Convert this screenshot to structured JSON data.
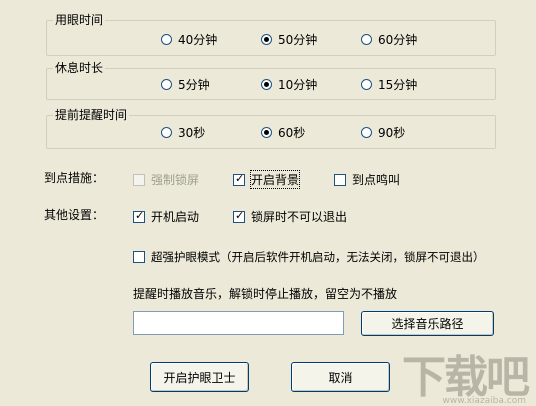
{
  "groups": [
    {
      "title": "用眼时间",
      "options": [
        "40分钟",
        "50分钟",
        "60分钟"
      ],
      "selected": 1
    },
    {
      "title": "休息时长",
      "options": [
        "5分钟",
        "10分钟",
        "15分钟"
      ],
      "selected": 1
    },
    {
      "title": "提前提醒时间",
      "options": [
        "30秒",
        "60秒",
        "90秒"
      ],
      "selected": 1
    }
  ],
  "arrival": {
    "label": "到点措施：",
    "force_lock": "强制锁屏",
    "open_background": "开启背景",
    "beep": "到点鸣叫"
  },
  "other": {
    "label": "其他设置：",
    "startup": "开机启动",
    "lock_no_exit": "锁屏时不可以退出",
    "super_mode": "超强护眼模式（开启后软件开机启动，无法关闭，锁屏不可退出）"
  },
  "music": {
    "hint": "提醒时播放音乐，解锁时停止播放，留空为不播放",
    "path_value": "",
    "choose_button": "选择音乐路径"
  },
  "buttons": {
    "start": "开启护眼卫士",
    "cancel": "取消"
  },
  "watermark": {
    "main": "下载吧",
    "sub": "www.xiazaiba.com"
  }
}
